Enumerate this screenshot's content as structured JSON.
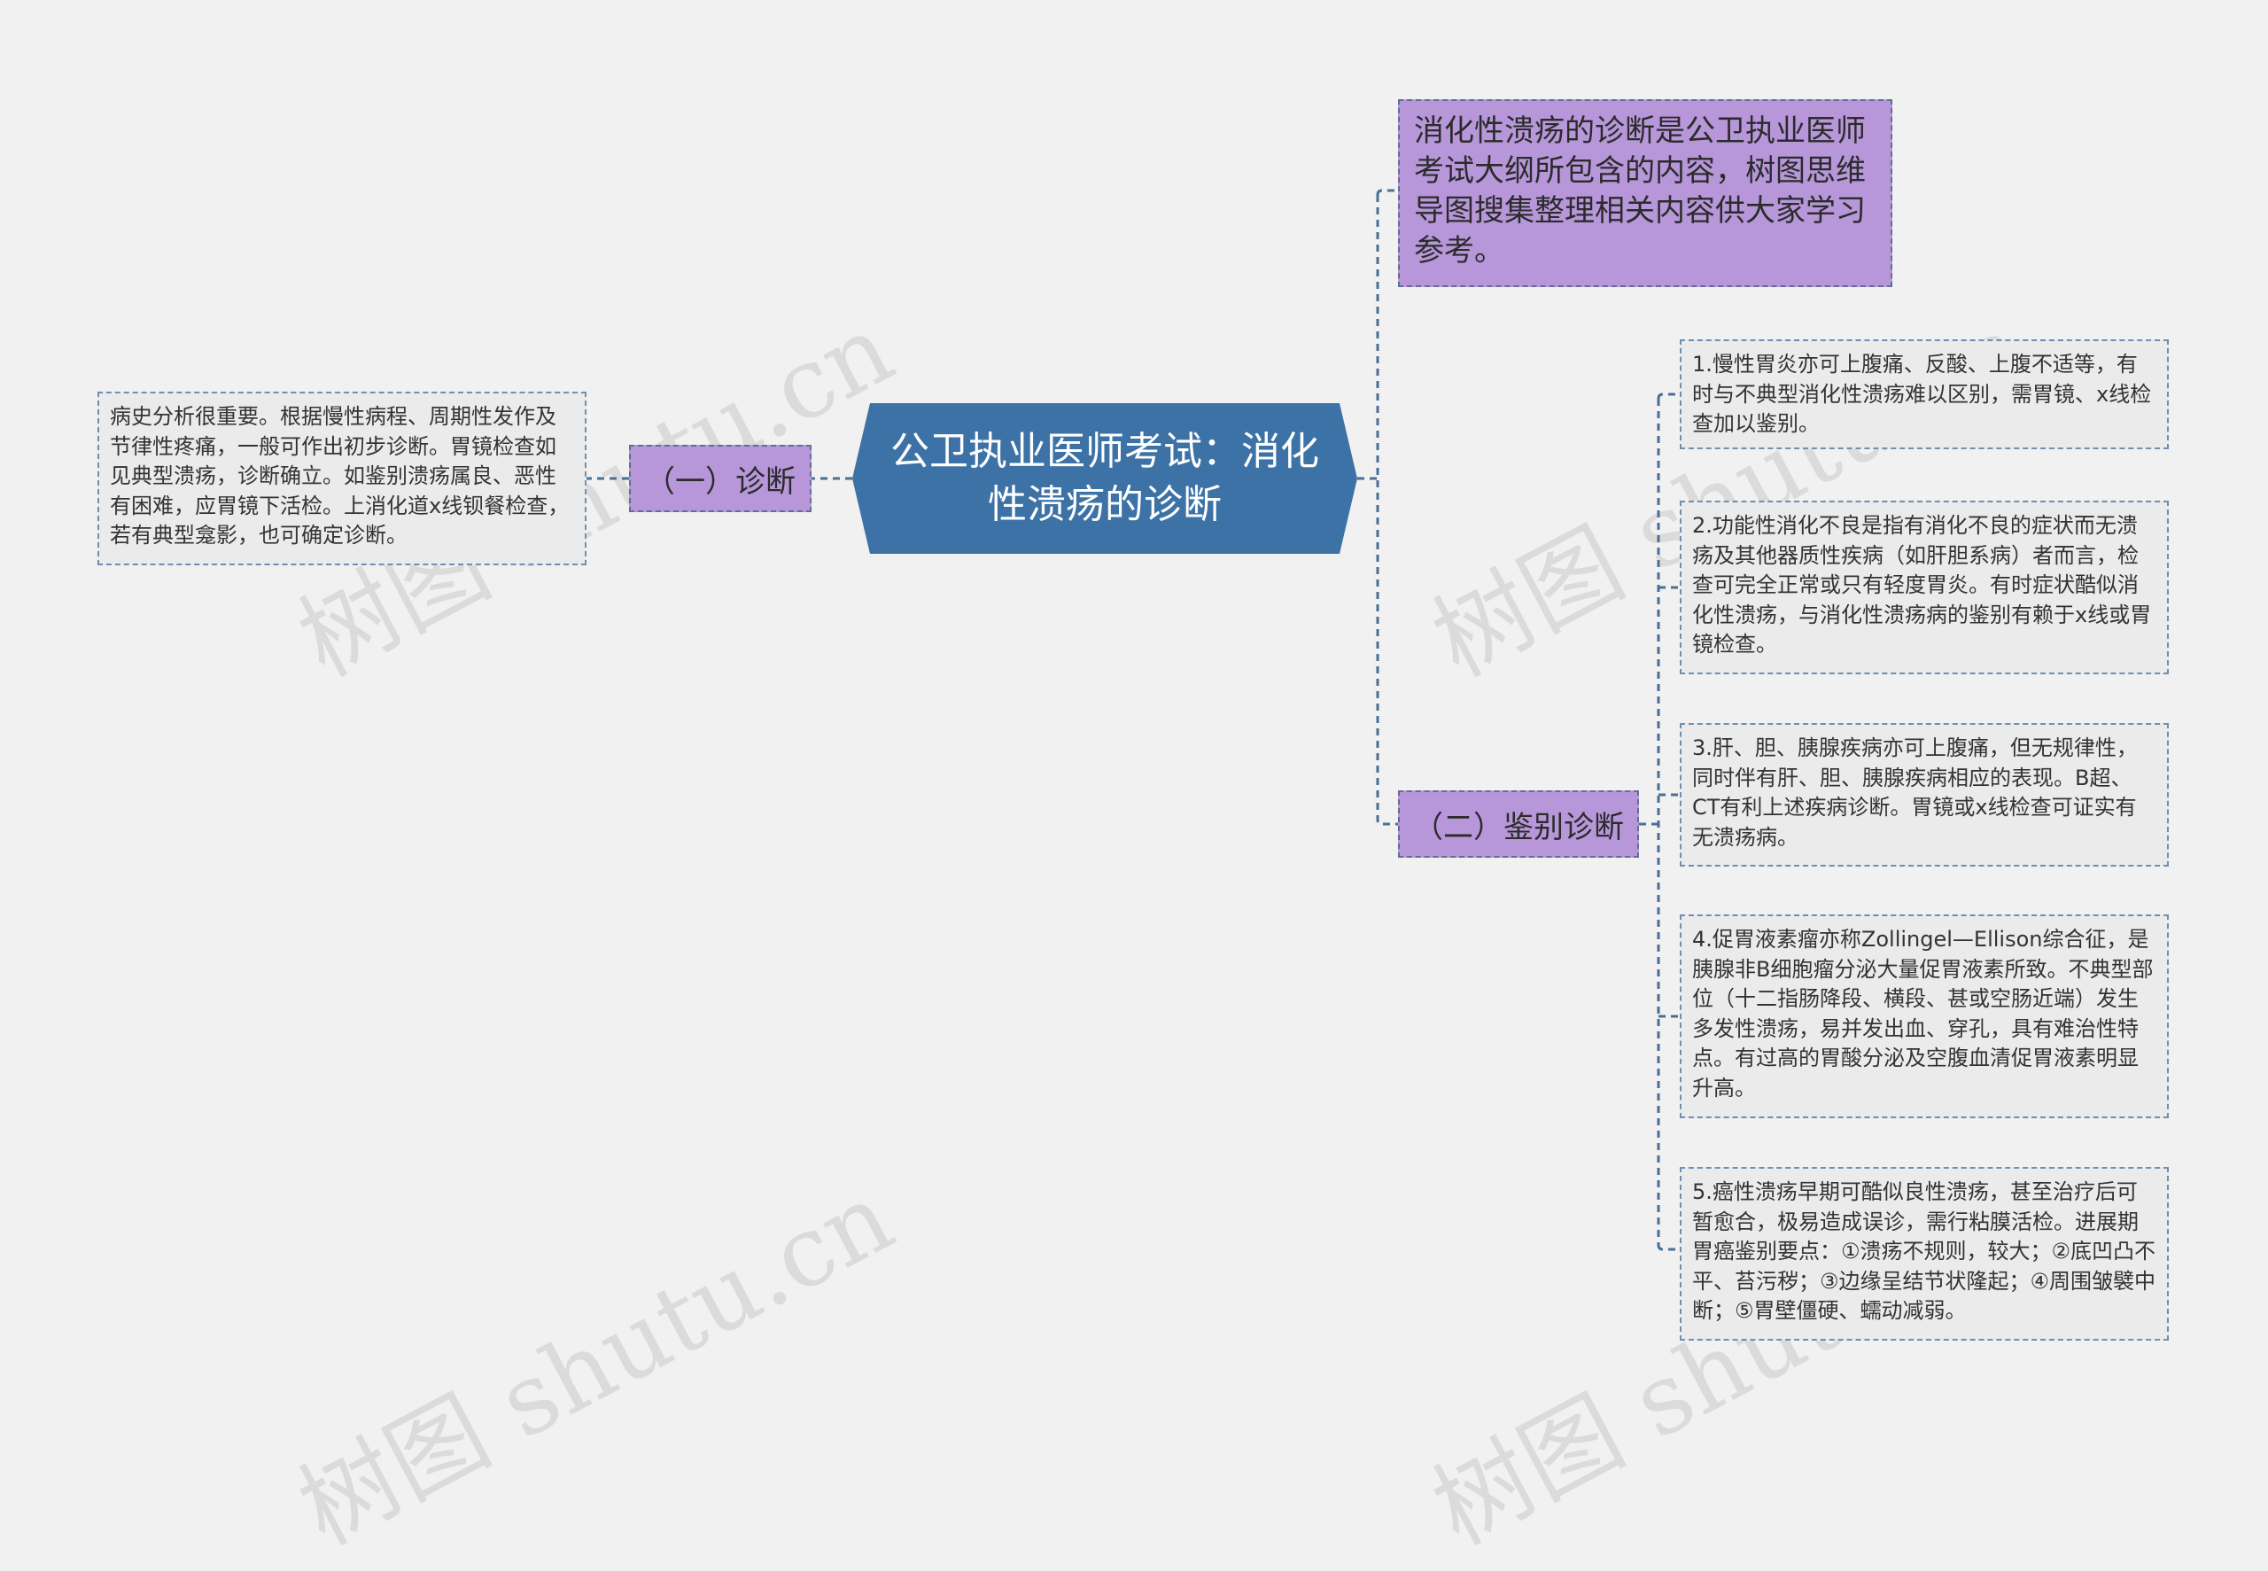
{
  "central": {
    "title": "公卫执业医师考试：消化性溃疡的诊断"
  },
  "intro": {
    "text": "消化性溃疡的诊断是公卫执业医师考试大纲所包含的内容，树图思维导图搜集整理相关内容供大家学习参考。"
  },
  "branches": [
    {
      "label": "（一）诊断"
    },
    {
      "label": "（二）鉴别诊断"
    }
  ],
  "left_leaf": {
    "text": "病史分析很重要。根据慢性病程、周期性发作及节律性疼痛，一般可作出初步诊断。胃镜检查如见典型溃疡，诊断确立。如鉴别溃疡属良、恶性有困难，应胃镜下活检。上消化道x线钡餐检查，若有典型龛影，也可确定诊断。"
  },
  "right_leaves": [
    {
      "text": "1.慢性胃炎亦可上腹痛、反酸、上腹不适等，有时与不典型消化性溃疡难以区别，需胃镜、x线检查加以鉴别。"
    },
    {
      "text": "2.功能性消化不良是指有消化不良的症状而无溃疡及其他器质性疾病（如肝胆系病）者而言，检查可完全正常或只有轻度胃炎。有时症状酷似消化性溃疡，与消化性溃疡病的鉴别有赖于x线或胃镜检查。"
    },
    {
      "text": "3.肝、胆、胰腺疾病亦可上腹痛，但无规律性，同时伴有肝、胆、胰腺疾病相应的表现。B超、CT有利上述疾病诊断。胃镜或x线检查可证实有无溃疡病。"
    },
    {
      "text": "4.促胃液素瘤亦称Zollingel—Ellison综合征，是胰腺非B细胞瘤分泌大量促胃液素所致。不典型部位（十二指肠降段、横段、甚或空肠近端）发生多发性溃疡，易并发出血、穿孔，具有难治性特点。有过高的胃酸分泌及空腹血清促胃液素明显升高。"
    },
    {
      "text": "5.癌性溃疡早期可酷似良性溃疡，甚至治疗后可暂愈合，极易造成误诊，需行粘膜活检。进展期胃癌鉴别要点：①溃疡不规则，较大；②底凹凸不平、苔污秽；③边缘呈结节状隆起；④周围皱襞中断；⑤胃壁僵硬、蠕动减弱。"
    }
  ],
  "watermark": "树图 shutu.cn",
  "colors": {
    "background": "#f1f1f1",
    "central_fill": "#3d72a6",
    "branch_fill": "#b797da",
    "leaf_fill": "#ebebeb",
    "connector": "#4a6f96"
  }
}
